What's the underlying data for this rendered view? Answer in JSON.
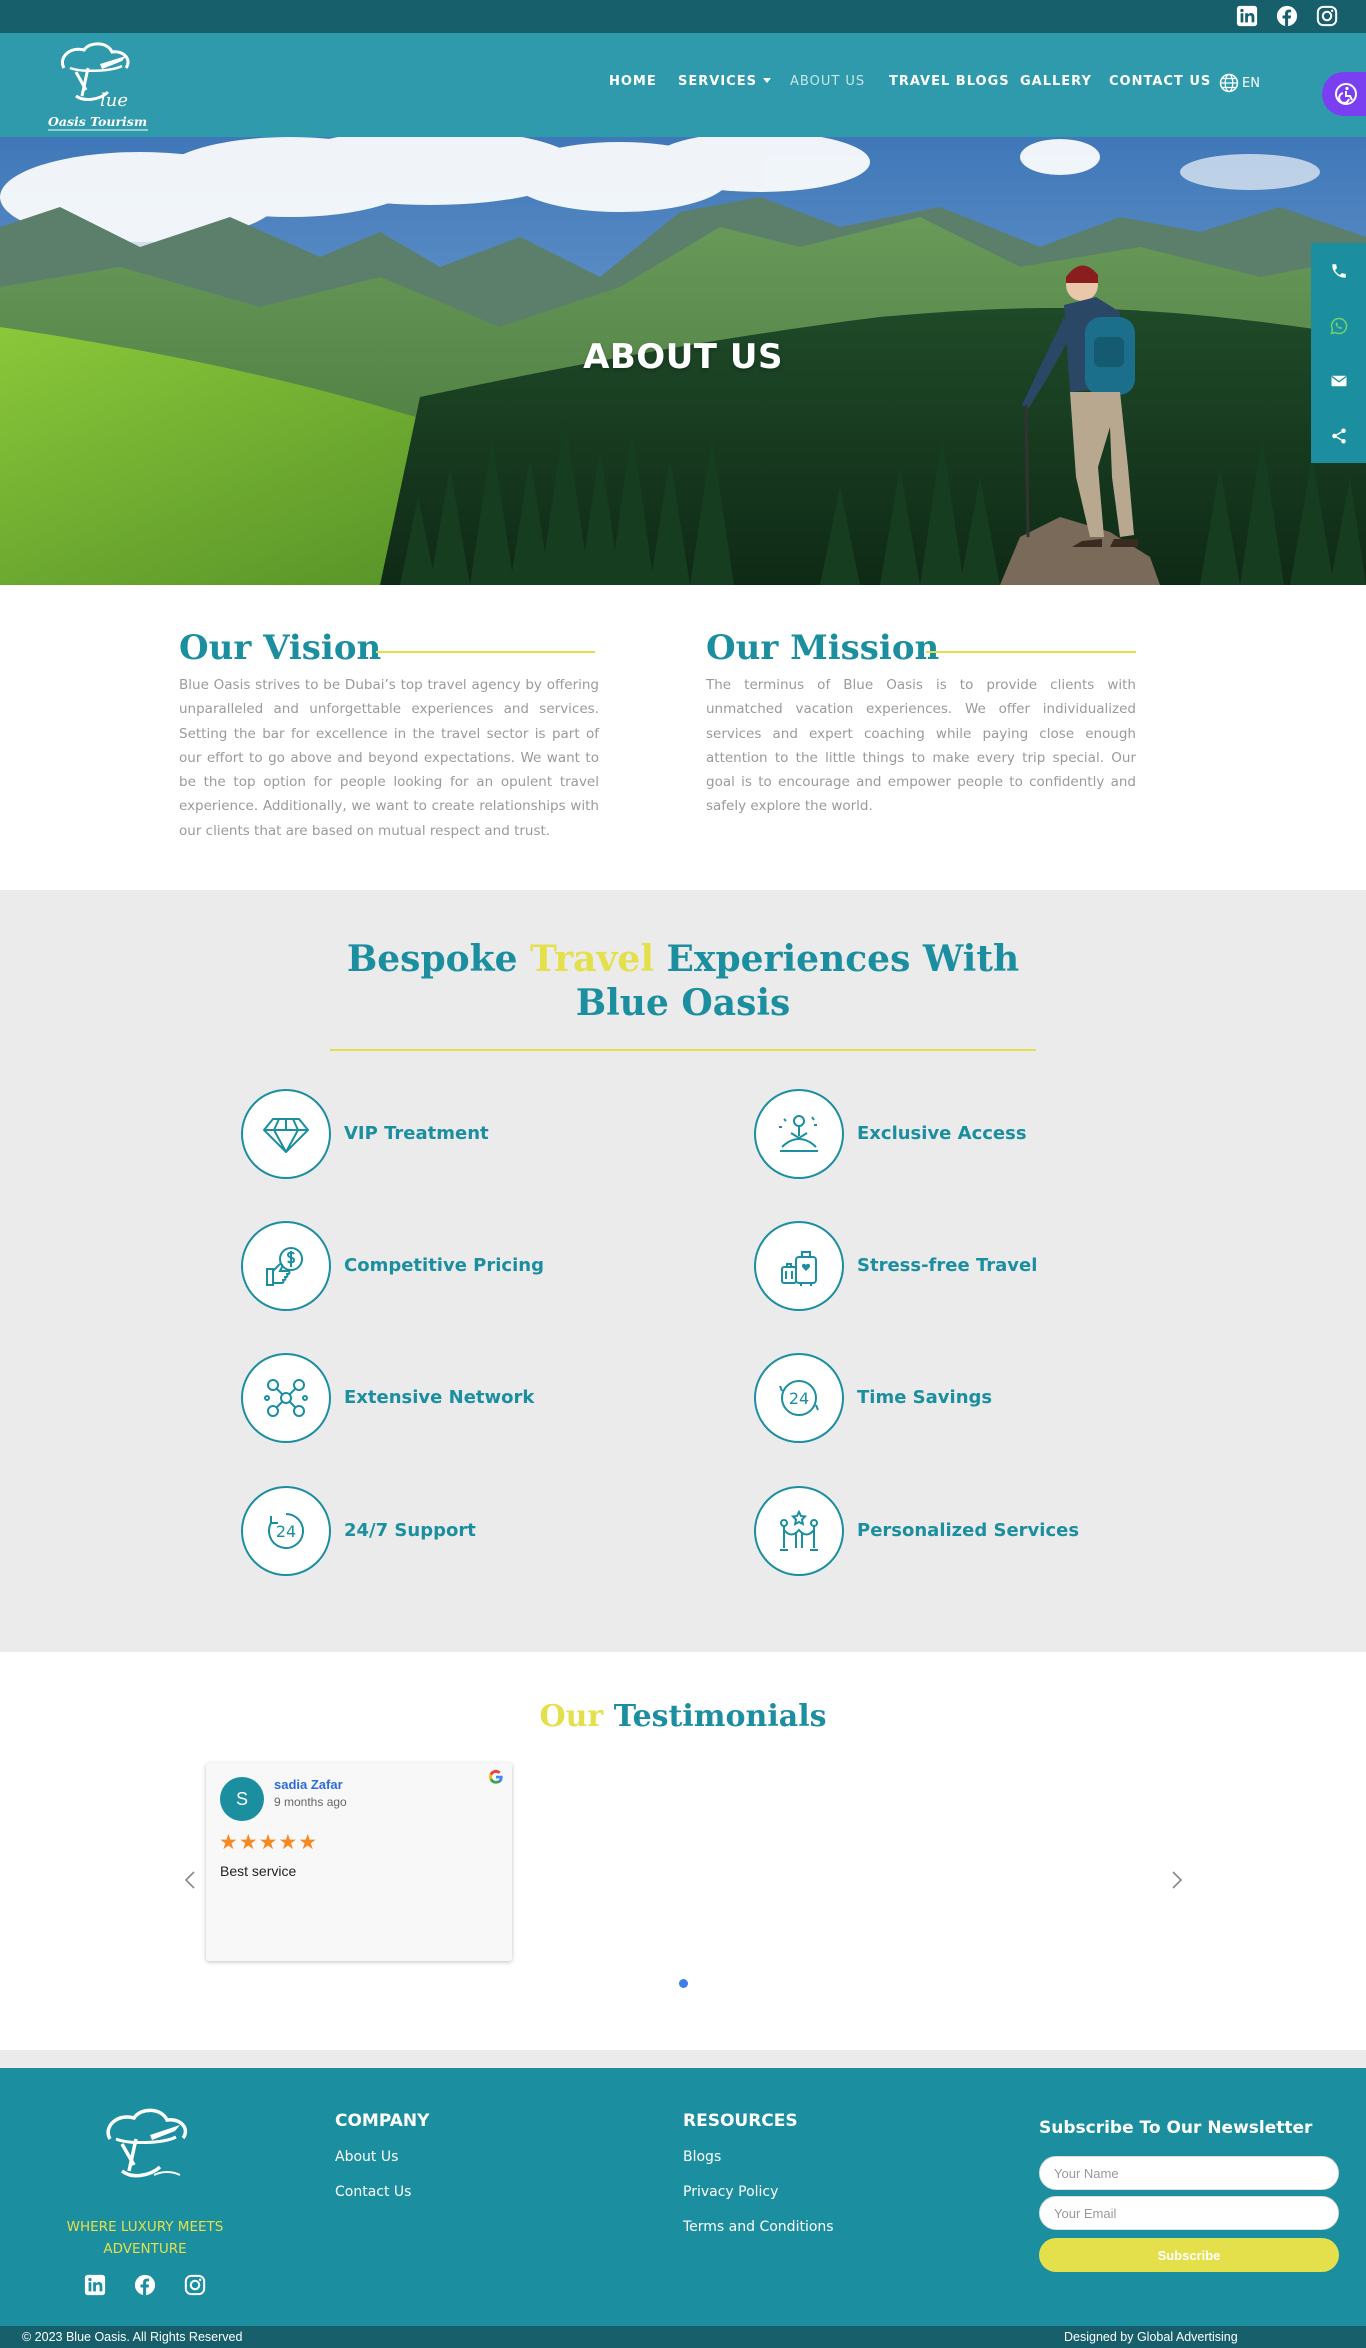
{
  "header": {
    "nav": [
      {
        "label": "HOME"
      },
      {
        "label": "SERVICES"
      },
      {
        "label": "ABOUT US"
      },
      {
        "label": "TRAVEL BLOGS"
      },
      {
        "label": "GALLERY"
      },
      {
        "label": "CONTACT US"
      }
    ],
    "language": "EN"
  },
  "icons": {
    "top_social": [
      "linkedin-icon",
      "facebook-icon",
      "instagram-icon"
    ],
    "float_bar": [
      "phone-icon",
      "whatsapp-icon",
      "email-icon",
      "share-icon"
    ],
    "accessibility": "accessibility-icon"
  },
  "hero": {
    "title": "ABOUT US"
  },
  "vision": {
    "title": "Our Vision",
    "text": "Blue Oasis strives to be Dubai’s top travel agency by offering unparalleled and unforgettable experiences and services. Setting the bar for excellence in the travel sector is part of our effort to go above and beyond expectations. We want to be the top option for people looking for an opulent travel experience. Additionally, we want to create relationships with our clients that are based on mutual respect and trust."
  },
  "mission": {
    "title": "Our Mission",
    "text": "The terminus of Blue Oasis is to provide clients with unmatched vacation experiences. We offer individualized services and expert coaching while paying close enough attention to the little things to make every trip special. Our goal is to encourage and empower people to confidently and safely explore the world."
  },
  "bespoke": {
    "title_part1": "Bespoke",
    "title_highlight": "Travel",
    "title_part2": "Experiences With",
    "title_line2": "Blue Oasis",
    "features": [
      {
        "label": "VIP Treatment",
        "icon": "diamond-icon"
      },
      {
        "label": "Exclusive Access",
        "icon": "meditation-icon"
      },
      {
        "label": "Competitive Pricing",
        "icon": "price-thumbs-up-icon"
      },
      {
        "label": "Stress-free Travel",
        "icon": "luggage-icon"
      },
      {
        "label": "Extensive Network",
        "icon": "network-icon"
      },
      {
        "label": "Time Savings",
        "icon": "clock-24-icon"
      },
      {
        "label": "24/7 Support",
        "icon": "support-24-icon"
      },
      {
        "label": "Personalized Services",
        "icon": "vip-rope-icon"
      }
    ]
  },
  "testimonials": {
    "title_highlight": "Our",
    "title_rest": "Testimonials",
    "review": {
      "initial": "S",
      "name": "sadia Zafar",
      "time": "9 months ago",
      "stars": "★★★★★",
      "rating": 5,
      "text": "Best service"
    }
  },
  "footer": {
    "tagline": "WHERE LUXURY MEETS ADVENTURE",
    "company": {
      "heading": "COMPANY",
      "links": [
        "About Us",
        "Contact Us"
      ]
    },
    "resources": {
      "heading": "RESOURCES",
      "links": [
        "Blogs",
        "Privacy Policy",
        "Terms and Conditions"
      ]
    },
    "newsletter": {
      "heading": "Subscribe To Our Newsletter",
      "name_placeholder": "Your Name",
      "email_placeholder": "Your Email",
      "button": "Subscribe"
    },
    "copyright": "© 2023 Blue Oasis. All Rights Reserved",
    "credit": "Designed by Global Advertising"
  },
  "colors": {
    "teal": "#1b8ea0",
    "header_teal": "#2f9aab",
    "dark_teal": "#17606b",
    "yellow": "#e4e04c",
    "star_orange": "#f58a25"
  }
}
